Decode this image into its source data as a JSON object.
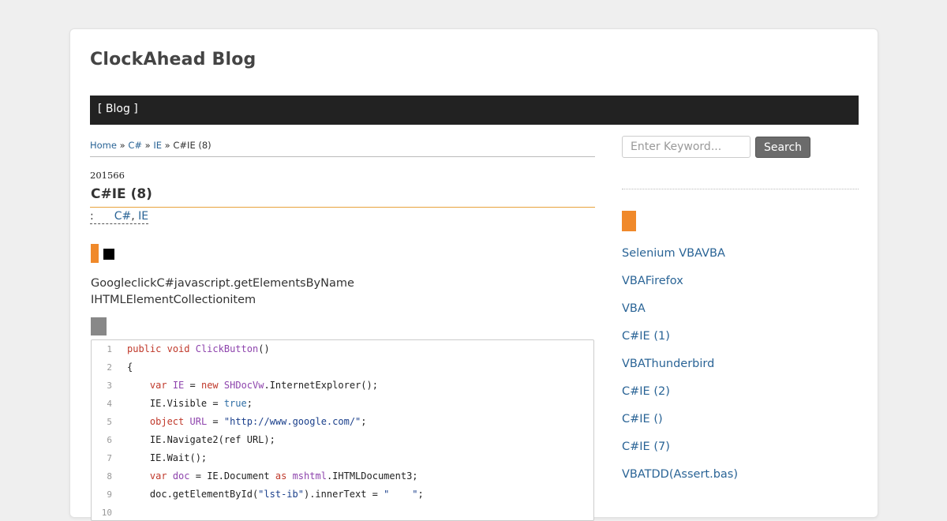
{
  "site": {
    "title": "ClockAhead Blog"
  },
  "nav": {
    "blog_label": "[ Blog ]"
  },
  "breadcrumb": {
    "home": "Home",
    "sep1": " » ",
    "cat1": "C#",
    "sep2": " » ",
    "cat2": "IE",
    "sep3": " » ",
    "current": "C#IE (8)"
  },
  "post": {
    "date": "201566",
    "title": "C#IE (8)",
    "meta_prefix": ":",
    "category1": "C#",
    "category_sep": ", ",
    "category2": "IE",
    "paragraph_line1": "GoogleclickC#javascript.getElementsByName",
    "paragraph_line2": "IHTMLElementCollectionitem"
  },
  "code": {
    "lines": [
      {
        "n": "1",
        "tokens": [
          {
            "t": "public",
            "c": "kw"
          },
          {
            "t": " "
          },
          {
            "t": "void",
            "c": "kw"
          },
          {
            "t": " "
          },
          {
            "t": "ClickButton",
            "c": "ty"
          },
          {
            "t": "()"
          }
        ]
      },
      {
        "n": "2",
        "tokens": [
          {
            "t": "{"
          }
        ]
      },
      {
        "n": "3",
        "tokens": [
          {
            "t": "    "
          },
          {
            "t": "var",
            "c": "kw"
          },
          {
            "t": " "
          },
          {
            "t": "IE",
            "c": "ty"
          },
          {
            "t": " = "
          },
          {
            "t": "new",
            "c": "kw"
          },
          {
            "t": " "
          },
          {
            "t": "SHDocVw",
            "c": "ty"
          },
          {
            "t": ".InternetExplorer();"
          }
        ]
      },
      {
        "n": "4",
        "tokens": [
          {
            "t": "    IE.Visible = "
          },
          {
            "t": "true",
            "c": "bool"
          },
          {
            "t": ";"
          }
        ]
      },
      {
        "n": "5",
        "tokens": [
          {
            "t": "    "
          },
          {
            "t": "object",
            "c": "kw"
          },
          {
            "t": " "
          },
          {
            "t": "URL",
            "c": "ty"
          },
          {
            "t": " = "
          },
          {
            "t": "\"http://www.google.com/\"",
            "c": "str"
          },
          {
            "t": ";"
          }
        ]
      },
      {
        "n": "6",
        "tokens": [
          {
            "t": "    IE.Navigate2(ref URL);"
          }
        ]
      },
      {
        "n": "7",
        "tokens": [
          {
            "t": "    IE.Wait();"
          }
        ]
      },
      {
        "n": "8",
        "tokens": [
          {
            "t": "    "
          },
          {
            "t": "var",
            "c": "kw"
          },
          {
            "t": " "
          },
          {
            "t": "doc",
            "c": "ty"
          },
          {
            "t": " = IE.Document "
          },
          {
            "t": "as",
            "c": "kw"
          },
          {
            "t": " "
          },
          {
            "t": "mshtml",
            "c": "ty"
          },
          {
            "t": ".IHTMLDocument3;"
          }
        ]
      },
      {
        "n": "9",
        "tokens": [
          {
            "t": "    doc.getElementById("
          },
          {
            "t": "\"lst-ib\"",
            "c": "str"
          },
          {
            "t": ").innerText = "
          },
          {
            "t": "\"    \"",
            "c": "str"
          },
          {
            "t": ";"
          }
        ]
      },
      {
        "n": "10",
        "tokens": [
          {
            "t": ""
          }
        ]
      }
    ]
  },
  "sidebar": {
    "search_placeholder": "Enter Keyword...",
    "search_button": "Search",
    "recent_posts": [
      "Selenium VBAVBA",
      "VBAFirefox",
      "VBA",
      "C#IE (1)",
      "VBAThunderbird",
      "C#IE (2)",
      "C#IE ()",
      "C#IE (7)",
      "VBATDD(Assert.bas)"
    ]
  },
  "colors": {
    "accent_orange": "#f0892a",
    "navbar": "#222222",
    "link": "#2a6496"
  }
}
